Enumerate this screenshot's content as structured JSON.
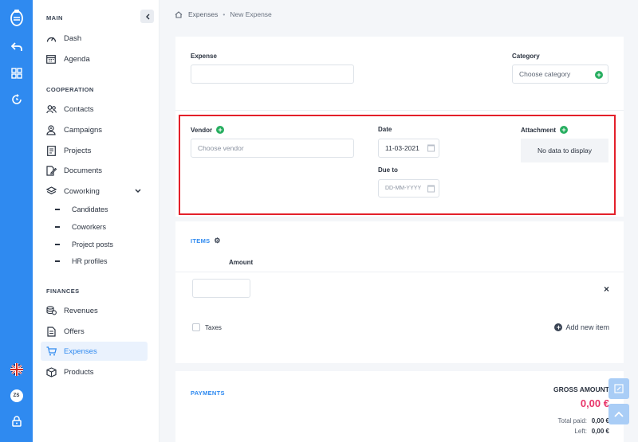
{
  "colors": {
    "primary": "#2f8af0",
    "success": "#27ae60",
    "highlight": "#e3202a",
    "amount": "#e8366a"
  },
  "rail": {
    "icons": [
      "logo-icon",
      "back-arrow-icon",
      "apps-grid-icon",
      "refresh-icon",
      "uk-flag-icon",
      "lock-icon"
    ],
    "avatar_initials": "ZS"
  },
  "sidebar": {
    "sections": {
      "main": "MAIN",
      "cooperation": "COOPERATION",
      "finances": "FINANCES"
    },
    "items": {
      "dash": "Dash",
      "agenda": "Agenda",
      "contacts": "Contacts",
      "campaigns": "Campaigns",
      "projects": "Projects",
      "documents": "Documents",
      "coworking": "Coworking",
      "candidates": "Candidates",
      "coworkers": "Coworkers",
      "project_posts": "Project posts",
      "hr_profiles": "HR profiles",
      "revenues": "Revenues",
      "offers": "Offers",
      "expenses": "Expenses",
      "products": "Products"
    }
  },
  "breadcrumb": {
    "home": "Expenses",
    "separator": "•",
    "current": "New Expense"
  },
  "form": {
    "expense_label": "Expense",
    "expense_value": "",
    "category_label": "Category",
    "category_placeholder": "Choose category",
    "vendor_label": "Vendor",
    "vendor_placeholder": "Choose vendor",
    "date_label": "Date",
    "date_value": "11-03-2021",
    "due_label": "Due to",
    "due_placeholder": "DD-MM-YYYY",
    "attachment_label": "Attachment",
    "attachment_empty": "No data to display"
  },
  "items": {
    "title": "ITEMS",
    "amount_header": "Amount",
    "amount_value": "",
    "remove_symbol": "×",
    "taxes_label": "Taxes",
    "add_new_label": "Add new item"
  },
  "payments": {
    "title": "PAYMENTS",
    "gross_label": "GROSS AMOUNT",
    "gross_value": "0,00 €",
    "total_paid_label": "Total paid:",
    "total_paid_value": "0,00 €",
    "left_label": "Left:",
    "left_value": "0,00 €"
  }
}
